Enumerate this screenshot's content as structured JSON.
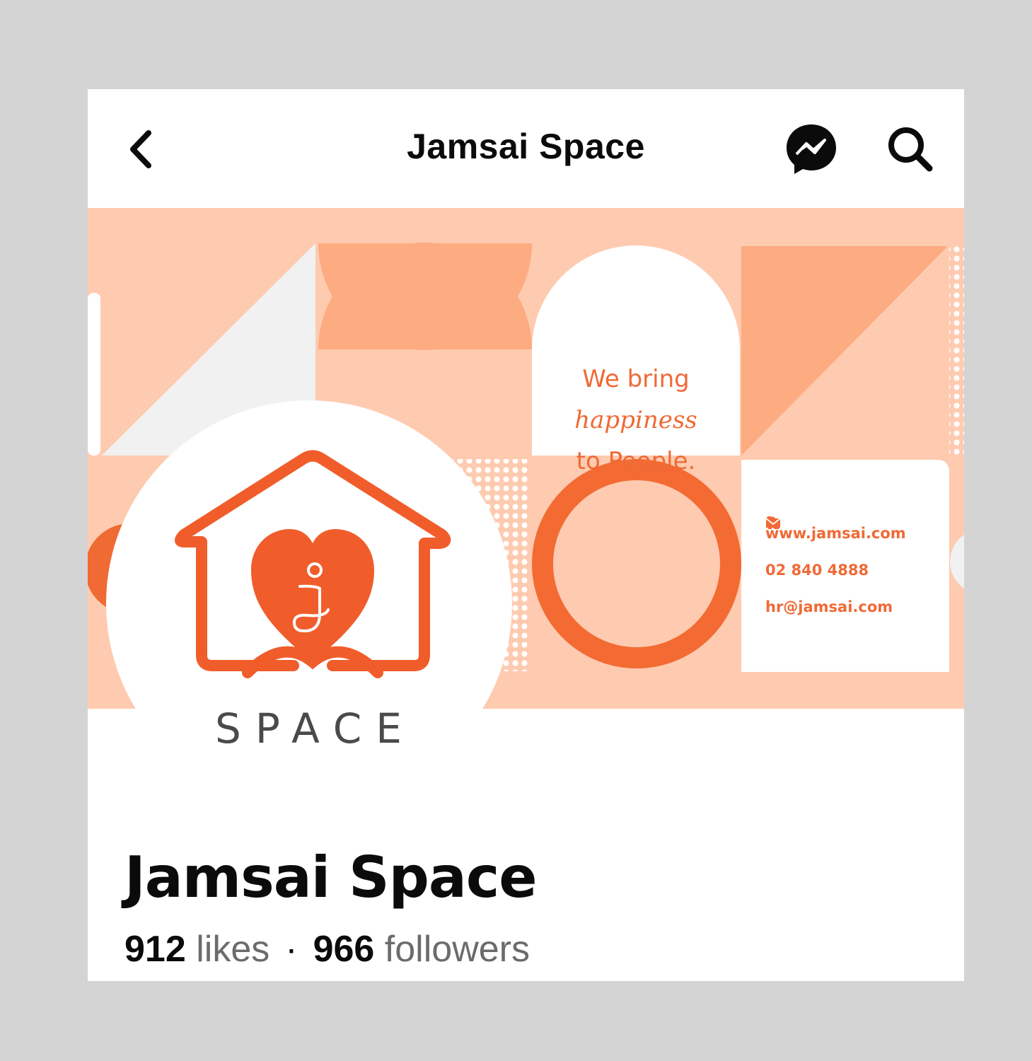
{
  "header": {
    "title": "Jamsai Space",
    "back_icon": "chevron-left-icon",
    "messenger_icon": "messenger-icon",
    "search_icon": "search-icon"
  },
  "cover": {
    "slogan_line1": "We bring",
    "slogan_line2": "happiness",
    "slogan_line3": "to People.",
    "website": "www.jamsai.com",
    "phone": "02 840 4888",
    "email": "hr@jamsai.com",
    "colors": {
      "peach": "#fecbb0",
      "mid": "#fdab80",
      "orange": "#f06a33",
      "white": "#ffffff"
    }
  },
  "avatar": {
    "wordmark": "SPACE"
  },
  "profile": {
    "name": "Jamsai Space",
    "likes_count": "912",
    "likes_label": "likes",
    "separator": "·",
    "followers_count": "966",
    "followers_label": "followers"
  }
}
